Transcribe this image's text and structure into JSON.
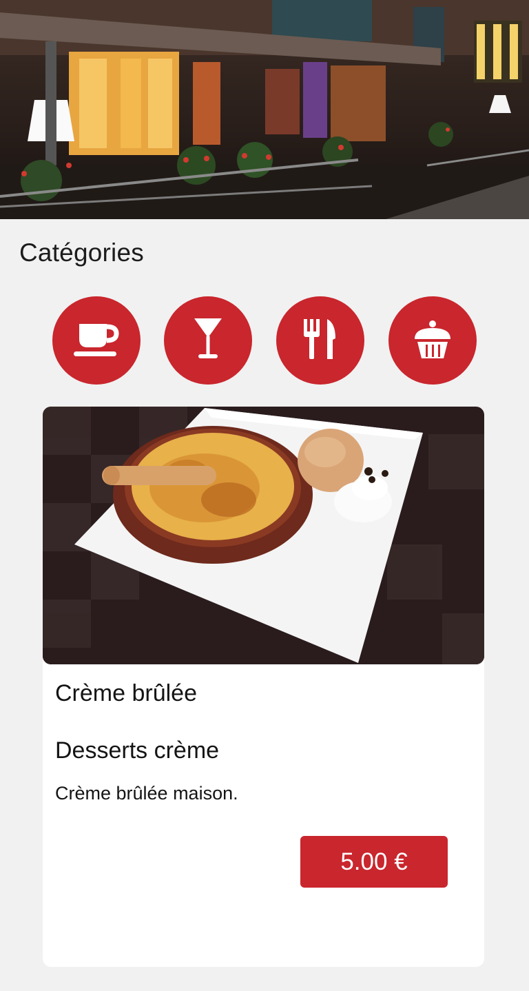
{
  "header": {
    "hero_image": "restaurant-terrace-photo"
  },
  "categories": {
    "title": "Catégories",
    "items": [
      {
        "icon": "coffee-cup-icon"
      },
      {
        "icon": "cocktail-glass-icon"
      },
      {
        "icon": "fork-knife-icon"
      },
      {
        "icon": "cupcake-icon"
      }
    ],
    "accent_color": "#c9262d"
  },
  "product": {
    "image": "creme-brulee-photo",
    "name": "Crème brûlée",
    "category": "Desserts crème",
    "description": "Crème brûlée maison.",
    "price": "5.00 €"
  }
}
